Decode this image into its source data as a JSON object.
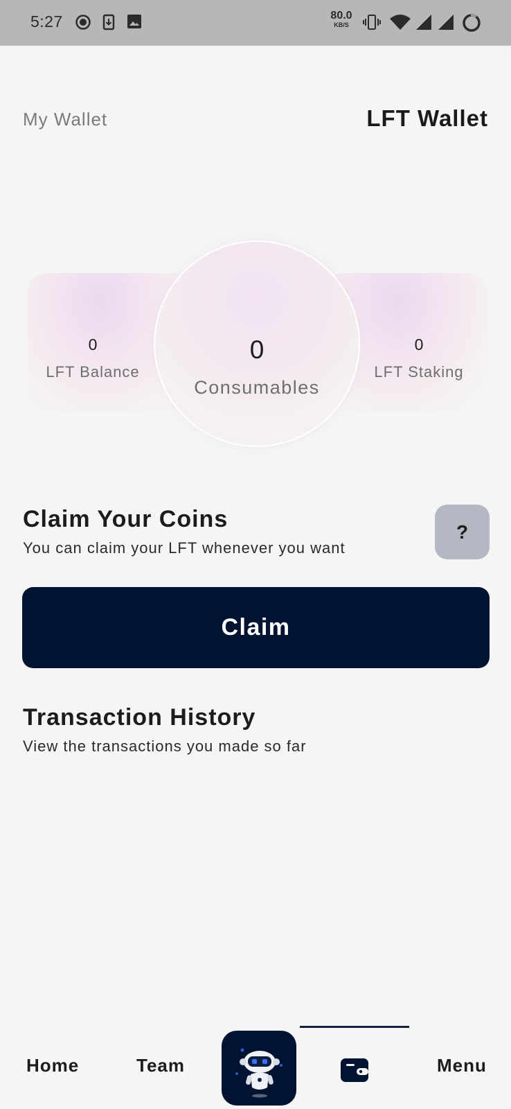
{
  "status_bar": {
    "time": "5:27",
    "net_speed_value": "80.0",
    "net_speed_unit": "KB/S",
    "icons": [
      "record-icon",
      "download-icon",
      "image-icon",
      "vibrate-icon",
      "wifi-icon",
      "signal-icon",
      "signal-icon",
      "battery-ring-icon"
    ]
  },
  "header": {
    "left_label": "My Wallet",
    "title": "LFT Wallet"
  },
  "stats": {
    "lft_balance": {
      "value": "0",
      "label": "LFT Balance"
    },
    "consumables": {
      "value": "0",
      "label": "Consumables"
    },
    "lft_staking": {
      "value": "0",
      "label": "LFT Staking"
    }
  },
  "claim": {
    "title": "Claim Your Coins",
    "subtitle": "You can claim your LFT whenever you want",
    "help_label": "?",
    "button_label": "Claim"
  },
  "transactions": {
    "title": "Transaction History",
    "subtitle": "View the transactions you made so far"
  },
  "bottom_nav": {
    "items": [
      {
        "label": "Home"
      },
      {
        "label": "Team"
      },
      {
        "icon": "robot-icon"
      },
      {
        "icon": "wallet-icon",
        "active": true
      },
      {
        "label": "Menu"
      }
    ]
  },
  "colors": {
    "background": "#f5f5f5",
    "status_bar": "#b7b7b7",
    "primary_dark": "#021331",
    "help_button": "#b3b8c3",
    "muted_text": "#7a7a7a"
  }
}
